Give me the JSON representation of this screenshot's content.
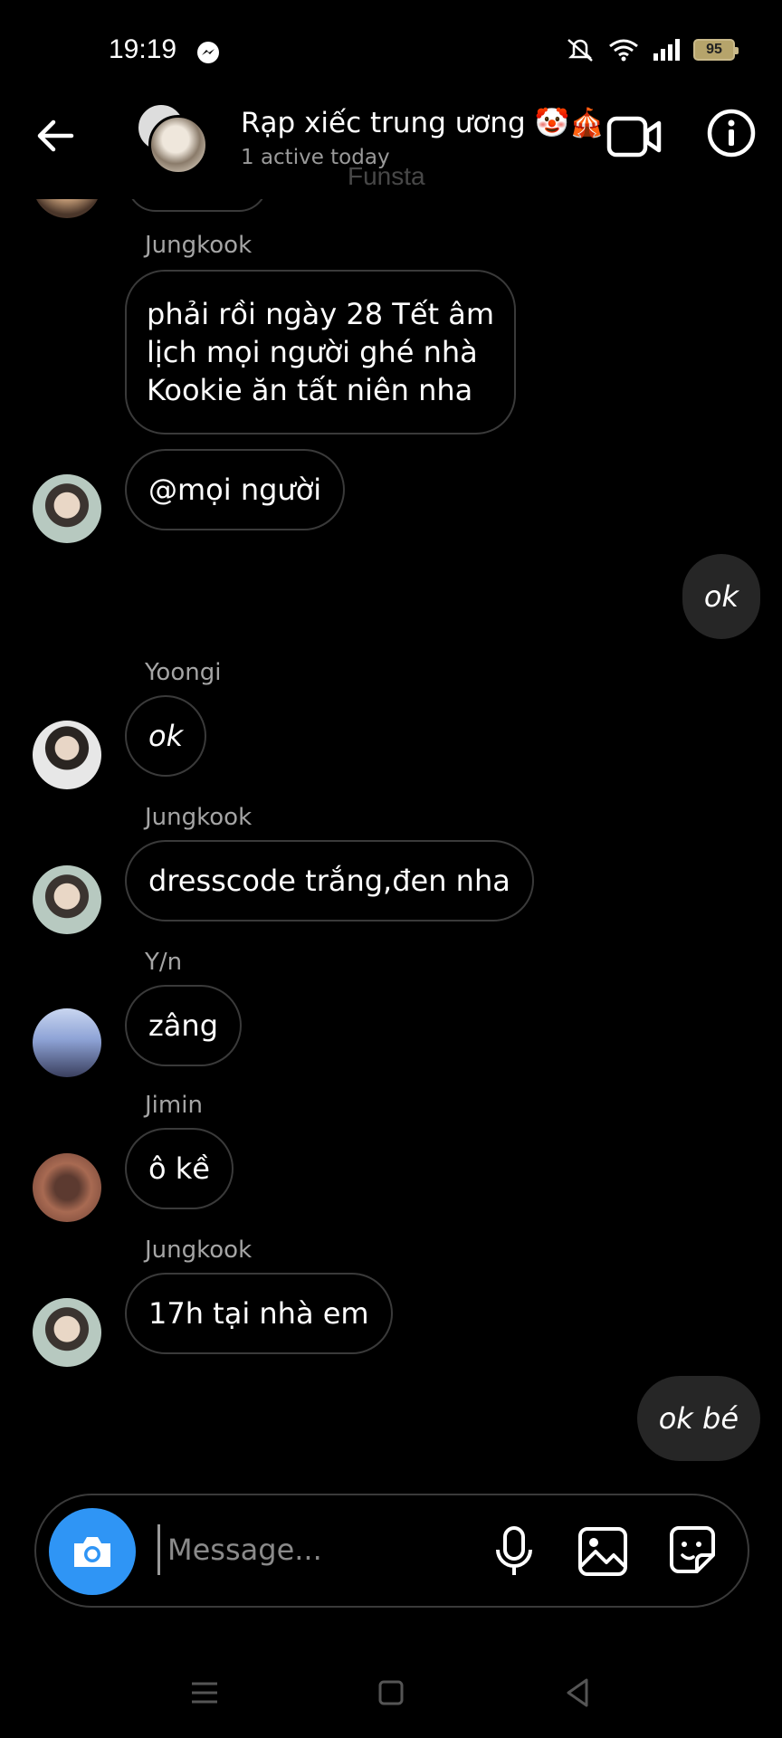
{
  "status": {
    "time": "19:19",
    "battery": "95",
    "icons": [
      "messenger-icon",
      "mute-icon",
      "wifi-icon",
      "signal-icon",
      "battery-icon"
    ]
  },
  "header": {
    "title": "Rạp xiếc trung ương 🤡🎪",
    "subtitle": "1 active today",
    "watermark": "Funsta"
  },
  "messages": [
    {
      "sender": "Jungkook",
      "lines": [
        "phải rồi ngày 28 Tết âm",
        "lịch mọi người ghé nhà",
        "Kookie ăn tất niên nha"
      ]
    },
    {
      "text": "@mọi người"
    },
    {
      "me": true,
      "text": "ok"
    },
    {
      "sender": "Yoongi",
      "text": "ok"
    },
    {
      "sender": "Jungkook",
      "text": "dresscode trắng,đen nha"
    },
    {
      "sender": "Y/n",
      "text": "zâng"
    },
    {
      "sender": "Jimin",
      "text": "ô kề"
    },
    {
      "sender": "Jungkook",
      "text": "17h tại nhà em"
    },
    {
      "me": true,
      "text": "ok bé"
    }
  ],
  "composer": {
    "placeholder": "Message..."
  },
  "colors": {
    "background": "#000000",
    "bubble_border": "#3a3a3a",
    "own_bubble": "#262626",
    "camera_button": "#2f95f5",
    "secondary_text": "#a5a5a5"
  }
}
